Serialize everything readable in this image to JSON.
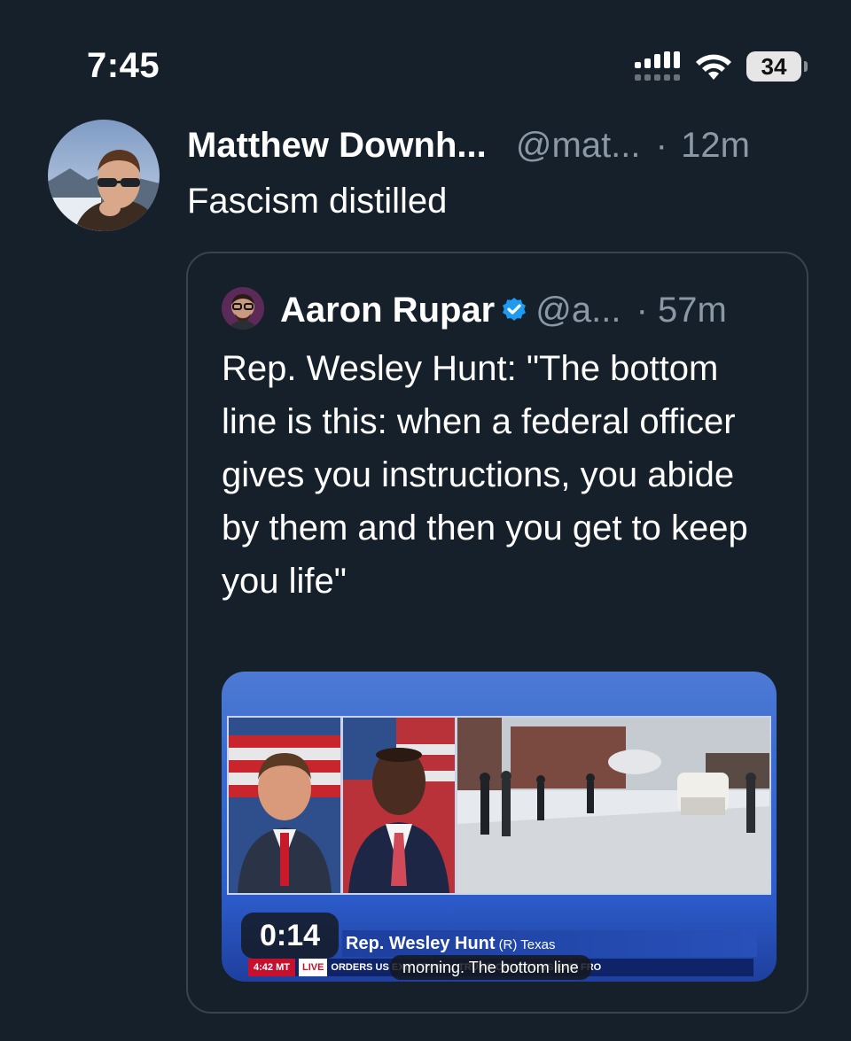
{
  "status_bar": {
    "time": "7:45",
    "battery": "34",
    "icons": [
      "signal-icon",
      "wifi-icon",
      "battery-icon"
    ]
  },
  "post": {
    "author_name": "Matthew Downh...",
    "handle": "@mat...",
    "separator": "·",
    "age": "12m",
    "text": "Fascism distilled"
  },
  "quote": {
    "author_name": "Aaron Rupar",
    "verified": true,
    "handle": "@a...",
    "separator": "·",
    "age": "57m",
    "text": "Rep. Wesley Hunt: \"The bottom line is this: when a federal officer gives you instructions, you abide by them and then you get to keep you life\"",
    "video": {
      "timestamp": "0:14",
      "lower_third_name": "Rep. Wesley Hunt",
      "lower_third_party": "(R) Texas",
      "ticker_time": "4:42 MT",
      "ticker_live": "LIVE",
      "ticker_text": "ORDERS US EXIT FROM ... TRUMP ORDERS US EXIT FRO",
      "caption": "morning. The bottom line"
    }
  },
  "colors": {
    "background": "#15202b",
    "text": "#e7e9ea",
    "muted": "#8b98a5",
    "border": "#38444d",
    "verified": "#1d9bf0"
  }
}
